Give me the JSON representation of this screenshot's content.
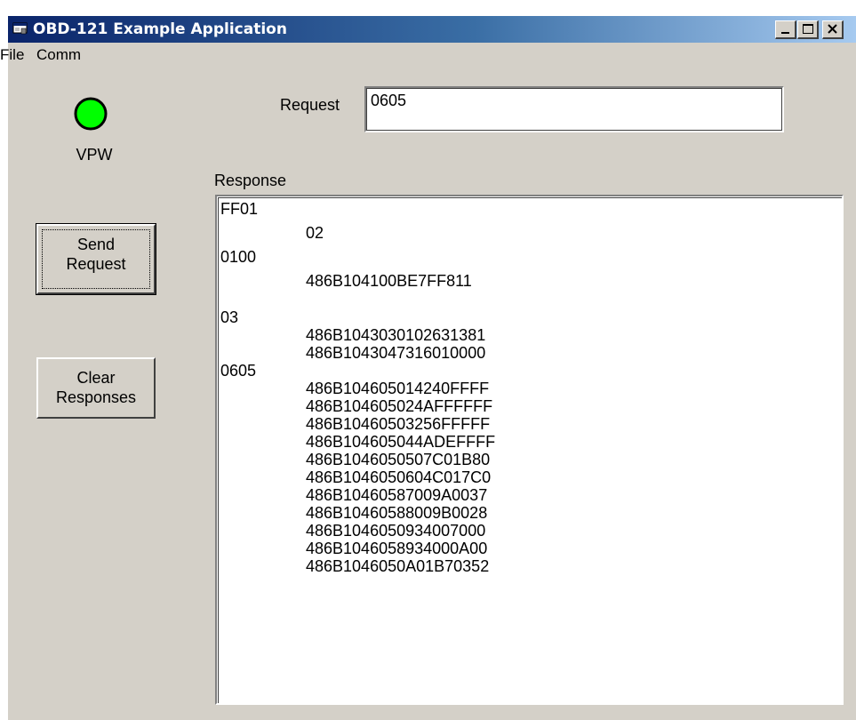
{
  "window": {
    "title": "OBD-121 Example Application"
  },
  "menu": {
    "file": "File",
    "comm": "Comm"
  },
  "status": {
    "indicator_color": "#00ff00",
    "protocol_label": "VPW"
  },
  "request": {
    "label": "Request",
    "value": "0605"
  },
  "buttons": {
    "send_line1": "Send",
    "send_line2": "Request",
    "clear_line1": "Clear",
    "clear_line2": "Responses"
  },
  "response": {
    "label": "Response",
    "lines": [
      "FF01",
      "02",
      "0100",
      "486B104100BE7FF811",
      "",
      "03",
      "486B1043030102631381",
      "486B1043047316010000",
      "0605",
      "486B104605014240FFFF",
      "486B104605024AFFFFFF",
      "486B10460503256FFFFF",
      "486B104605044ADEFFFF",
      "486B1046050507C01B80",
      "486B1046050604C017C0",
      "486B10460587009A0037",
      "486B10460588009B0028",
      "486B1046050934007000",
      "486B1046058934000A00",
      "486B1046050A01B70352"
    ]
  }
}
